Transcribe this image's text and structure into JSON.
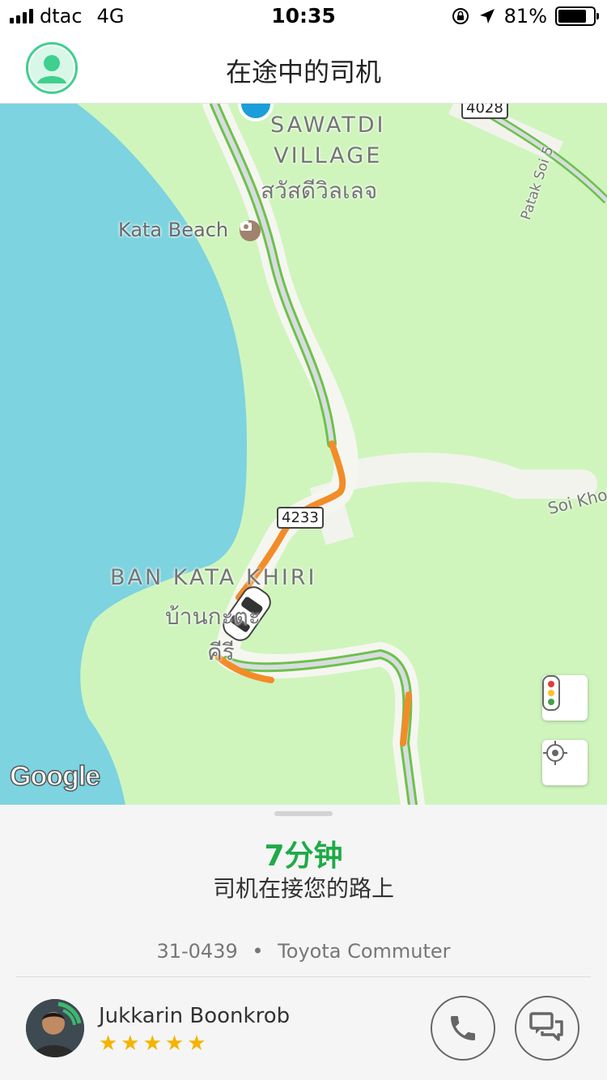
{
  "status_bar": {
    "carrier": "dtac",
    "network": "4G",
    "time": "10:35",
    "battery": "81%",
    "battery_level": 0.81
  },
  "header": {
    "title": "在途中的司机",
    "profile_icon": "user-icon"
  },
  "map": {
    "place_labels": {
      "sawatdi_en_1": "SAWATDI",
      "sawatdi_en_2": "VILLAGE",
      "sawatdi_th": "สวัสดีวิลเลจ",
      "kata_beach": "Kata Beach",
      "patak_soi": "Patak Soi 5",
      "soi_khok": "Soi Khok",
      "ban_kata_en": "BAN KATA KHIRI",
      "ban_kata_th_1": "บ้านกะตะ",
      "ban_kata_th_2": "คีรี"
    },
    "road_shields": {
      "r4028": "4028",
      "r4233": "4233"
    },
    "google_logo": "Google",
    "colors": {
      "water": "#7dd3df",
      "land": "#cff5bd",
      "route_green": "#6cc24a",
      "route_orange": "#f28c28"
    },
    "traffic_button_icon": "traffic-light-icon",
    "locate_button_icon": "crosshair-icon"
  },
  "trip": {
    "eta": "7分钟",
    "status": "司机在接您的路上",
    "plate": "31-0439",
    "separator": "•",
    "vehicle_model": "Toyota Commuter"
  },
  "driver": {
    "name": "Jukkarin Boonkrob",
    "rating": 5,
    "stars": "★★★★★",
    "call_icon": "phone-icon",
    "chat_icon": "chat-icon"
  }
}
